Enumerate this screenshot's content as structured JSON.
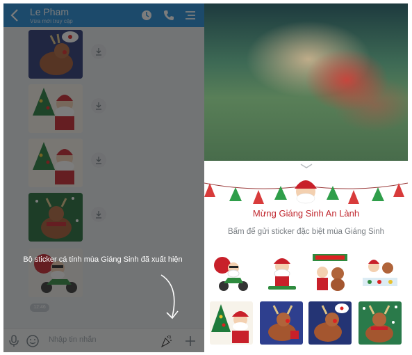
{
  "header": {
    "back_icon": "chevron-left-icon",
    "contact_name": "Le Pham",
    "contact_status": "Vừa mới truy cập",
    "icons": [
      "clock-phone-icon",
      "phone-icon",
      "menu-icon"
    ],
    "color": "#1c88d6"
  },
  "chat": {
    "sticker_count": 5,
    "download_icon": "download-icon",
    "timestamp": "12:46"
  },
  "input_bar": {
    "placeholder": "Nhập tin nhắn",
    "icons": [
      "microphone-icon",
      "emoji-icon",
      "party-popper-icon",
      "plus-icon"
    ]
  },
  "tooltip": {
    "text": "Bộ sticker cá tính mùa Giáng Sinh đã xuất hiện"
  },
  "promo": {
    "title": "Mừng Giáng Sinh An Lành",
    "subtitle": "Bấm để gửi sticker đặc biệt mùa Giáng Sinh",
    "title_color": "#c0262d",
    "sticker_grid": [
      "santa-motorbike",
      "santa-skateboard",
      "merry-xmas-santa-reindeer",
      "santa-party",
      "santa-tree",
      "reindeer-blue",
      "reindeer-gift-night",
      "reindeer-snow"
    ]
  }
}
